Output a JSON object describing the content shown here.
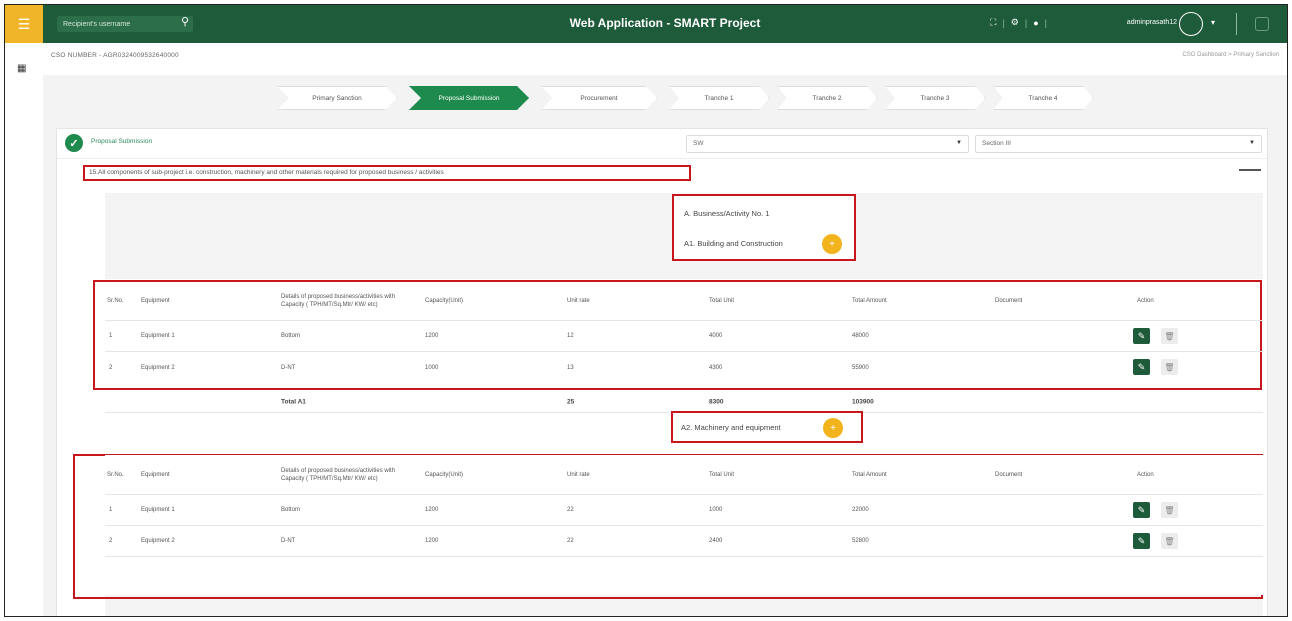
{
  "app": {
    "title": "Web Application - SMART Project"
  },
  "topbar": {
    "search_placeholder": "Recipient's username",
    "user": "adminprasath12"
  },
  "subheader": {
    "cso_number": "CSO NUMBER - AGR0324009532640000",
    "breadcrumb": "CSO Dashboard  >  Primary Sanction"
  },
  "stepper": [
    "Primary Sanction",
    "Proposal Submission",
    "Procurement",
    "Tranche 1",
    "Tranche 2",
    "Tranche 3",
    "Tranche 4"
  ],
  "section": {
    "title": "Proposal Submission",
    "select1": "SW",
    "select2": "Section III"
  },
  "question": "15.All components of sub-project i.e. construction, machinery and other materials required for proposed business / activities",
  "business": {
    "activity": "A. Business/Activity No. 1",
    "a1": "A1. Building and Construction",
    "a2": "A2. Machinery and equipment"
  },
  "table_headers": {
    "srno": "Sr.No.",
    "equipment": "Equipment",
    "details": "Details of proposed business/activities with Capacity ( TPH/MT/Sq.Mtr/ KW/ etc)",
    "capacity": "Capacity(Unit)",
    "unit_rate": "Unit rate",
    "total_unit": "Total Unit",
    "total_amount": "Total Amount",
    "document": "Document",
    "action": "Action"
  },
  "table_a1": [
    {
      "srno": "1",
      "equipment": "Equipment 1",
      "details": "Bottom",
      "capacity": "1200",
      "unit_rate": "12",
      "total_unit": "4000",
      "total_amount": "48000",
      "document": ""
    },
    {
      "srno": "2",
      "equipment": "Equipment 2",
      "details": "D-NT",
      "capacity": "1000",
      "unit_rate": "13",
      "total_unit": "4300",
      "total_amount": "55900",
      "document": ""
    }
  ],
  "total_a1": {
    "label": "Total A1",
    "unit_rate": "25",
    "total_unit": "8300",
    "total_amount": "103900"
  },
  "table_a2": [
    {
      "srno": "1",
      "equipment": "Equipment 1",
      "details": "Bottom",
      "capacity": "1200",
      "unit_rate": "22",
      "total_unit": "1000",
      "total_amount": "22000",
      "document": ""
    },
    {
      "srno": "2",
      "equipment": "Equipment 2",
      "details": "D-NT",
      "capacity": "1200",
      "unit_rate": "22",
      "total_unit": "2400",
      "total_amount": "52800",
      "document": ""
    }
  ],
  "colors": {
    "brand_green": "#1e5b3b",
    "accent_green": "#1f8a4e",
    "menu_yellow": "#f0b528",
    "highlight_red": "#c8161d",
    "add_orange": "#f2b31c"
  }
}
